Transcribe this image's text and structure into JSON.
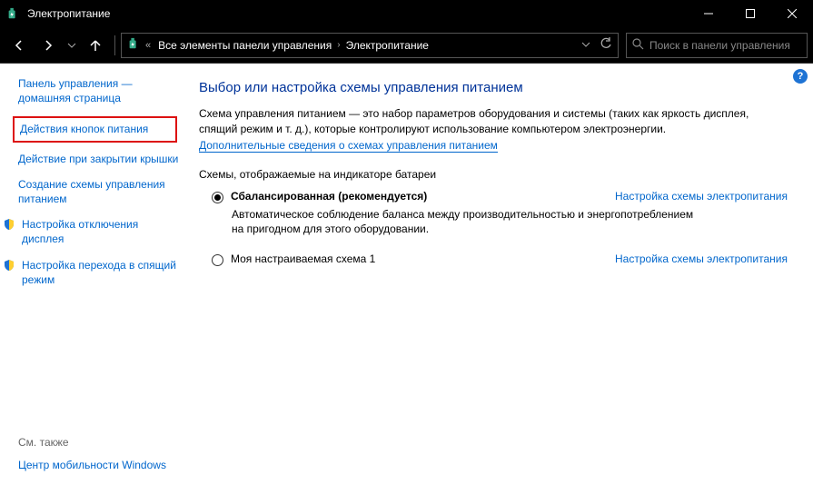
{
  "window": {
    "title": "Электропитание"
  },
  "breadcrumb": {
    "prefix": "«",
    "item1": "Все элементы панели управления",
    "item2": "Электропитание"
  },
  "search": {
    "placeholder": "Поиск в панели управления"
  },
  "sidebar": {
    "home": "Панель управления — домашняя страница",
    "buttons_action": "Действия кнопок питания",
    "lid_action": "Действие при закрытии крышки",
    "create_plan": "Создание схемы управления питанием",
    "display_off": "Настройка отключения дисплея",
    "sleep": "Настройка перехода в спящий режим",
    "see_also": "См. также",
    "mobility": "Центр мобильности Windows"
  },
  "main": {
    "heading": "Выбор или настройка схемы управления питанием",
    "desc": "Схема управления питанием — это набор параметров оборудования и системы (таких как яркость дисплея, спящий режим и т. д.), которые контролируют использование компьютером электроэнергии.",
    "more_link": "Дополнительные сведения о схемах управления питанием",
    "section": "Схемы, отображаемые на индикаторе батареи",
    "plan1_name": "Сбалансированная (рекомендуется)",
    "plan1_desc": "Автоматическое соблюдение баланса между производительностью и энергопотреблением на пригодном для этого оборудовании.",
    "plan2_name": "Моя настраиваемая схема 1",
    "configure_link": "Настройка схемы электропитания"
  }
}
